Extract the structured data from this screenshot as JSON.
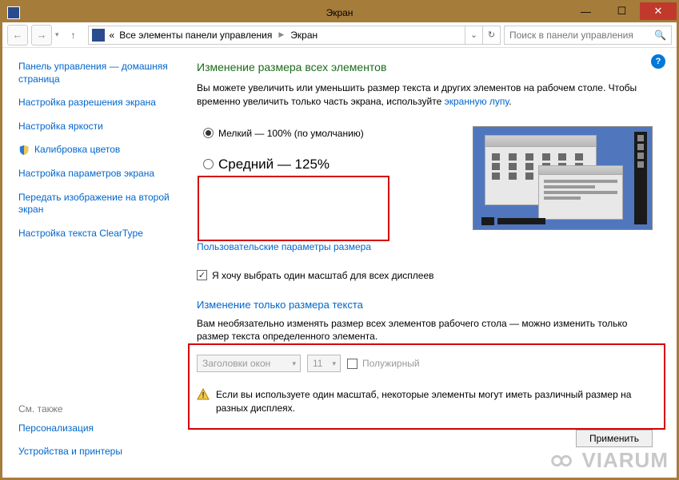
{
  "window": {
    "title": "Экран"
  },
  "nav": {
    "breadcrumb_prefix": "«",
    "breadcrumb1": "Все элементы панели управления",
    "breadcrumb2": "Экран",
    "search_placeholder": "Поиск в панели управления"
  },
  "sidebar": {
    "items": [
      "Панель управления — домашняя страница",
      "Настройка разрешения экрана",
      "Настройка яркости",
      "Калибровка цветов",
      "Настройка параметров экрана",
      "Передать изображение на второй экран",
      "Настройка текста ClearType"
    ],
    "footer_title": "См. также",
    "footer_items": [
      "Персонализация",
      "Устройства и принтеры"
    ]
  },
  "main": {
    "heading": "Изменение размера всех элементов",
    "desc1": "Вы можете увеличить или уменьшить размер текста и других элементов на рабочем столе. Чтобы временно увеличить только часть экрана, используйте ",
    "magnifier_link": "экранную лупу",
    "radio_small": "Мелкий — 100% (по умолчанию)",
    "radio_medium": "Средний — 125%",
    "custom_link": "Пользовательские параметры размера",
    "checkbox_label": "Я хочу выбрать один масштаб для всех дисплеев",
    "section2_heading": "Изменение только размера текста",
    "section2_desc": "Вам необязательно изменять размер всех элементов рабочего стола — можно изменить только размер текста определенного элемента.",
    "combo_item": "Заголовки окон",
    "combo_size": "11",
    "bold_label": "Полужирный",
    "warning": "Если вы используете один масштаб, некоторые элементы могут иметь различный размер на разных дисплеях.",
    "apply": "Применить"
  },
  "watermark": "VIARUM"
}
